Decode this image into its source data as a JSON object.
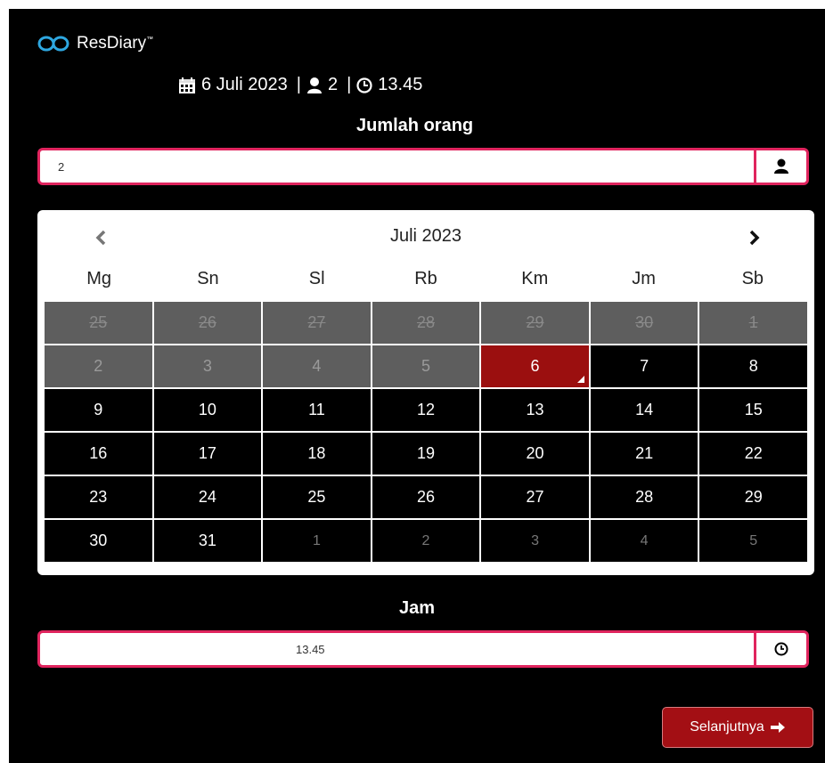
{
  "brand": {
    "name": "ResDiary",
    "tm": "™"
  },
  "summary": {
    "date": "6 Juli 2023",
    "sep1": "|",
    "guests": "2",
    "sep2": "|",
    "time": "13.45"
  },
  "people": {
    "label": "Jumlah orang",
    "value": "2"
  },
  "calendar": {
    "month": "Juli 2023",
    "weekdays": [
      "Mg",
      "Sn",
      "Sl",
      "Rb",
      "Km",
      "Jm",
      "Sb"
    ],
    "days": [
      {
        "d": "25",
        "s": "disabled"
      },
      {
        "d": "26",
        "s": "disabled"
      },
      {
        "d": "27",
        "s": "disabled"
      },
      {
        "d": "28",
        "s": "disabled"
      },
      {
        "d": "29",
        "s": "disabled"
      },
      {
        "d": "30",
        "s": "disabled"
      },
      {
        "d": "1",
        "s": "disabled"
      },
      {
        "d": "2",
        "s": "blocked"
      },
      {
        "d": "3",
        "s": "blocked"
      },
      {
        "d": "4",
        "s": "blocked"
      },
      {
        "d": "5",
        "s": "blocked"
      },
      {
        "d": "6",
        "s": "selected"
      },
      {
        "d": "7",
        "s": "available"
      },
      {
        "d": "8",
        "s": "available"
      },
      {
        "d": "9",
        "s": "available"
      },
      {
        "d": "10",
        "s": "available"
      },
      {
        "d": "11",
        "s": "available"
      },
      {
        "d": "12",
        "s": "available"
      },
      {
        "d": "13",
        "s": "available"
      },
      {
        "d": "14",
        "s": "available"
      },
      {
        "d": "15",
        "s": "available"
      },
      {
        "d": "16",
        "s": "available"
      },
      {
        "d": "17",
        "s": "available"
      },
      {
        "d": "18",
        "s": "available"
      },
      {
        "d": "19",
        "s": "available"
      },
      {
        "d": "20",
        "s": "available"
      },
      {
        "d": "21",
        "s": "available"
      },
      {
        "d": "22",
        "s": "available"
      },
      {
        "d": "23",
        "s": "available"
      },
      {
        "d": "24",
        "s": "available"
      },
      {
        "d": "25",
        "s": "available"
      },
      {
        "d": "26",
        "s": "available"
      },
      {
        "d": "27",
        "s": "available"
      },
      {
        "d": "28",
        "s": "available"
      },
      {
        "d": "29",
        "s": "available"
      },
      {
        "d": "30",
        "s": "available"
      },
      {
        "d": "31",
        "s": "available"
      },
      {
        "d": "1",
        "s": "othermonth"
      },
      {
        "d": "2",
        "s": "othermonth"
      },
      {
        "d": "3",
        "s": "othermonth"
      },
      {
        "d": "4",
        "s": "othermonth"
      },
      {
        "d": "5",
        "s": "othermonth"
      }
    ]
  },
  "time": {
    "label": "Jam",
    "value": "13.45"
  },
  "next_button": {
    "label": "Selanjutnya"
  },
  "colors": {
    "accent": "#e0245e",
    "selected": "#9b0f0f",
    "button": "#a30f14"
  },
  "icons": [
    "resdiary-logo-icon",
    "calendar-icon",
    "user-icon",
    "clock-icon",
    "chevron-left-icon",
    "chevron-right-icon",
    "arrow-right-icon"
  ]
}
